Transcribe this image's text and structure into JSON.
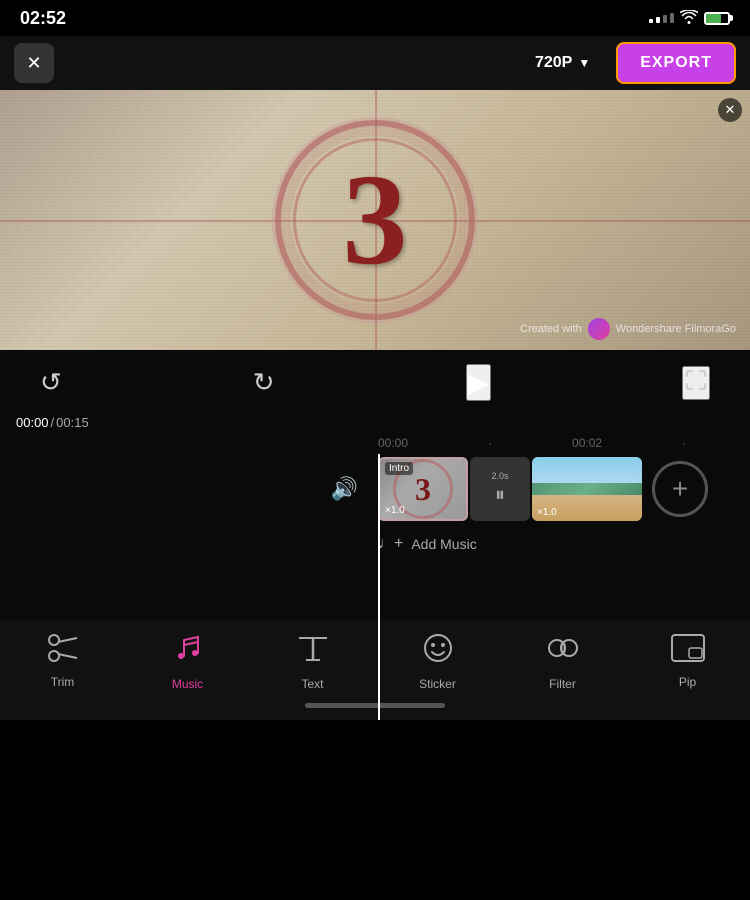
{
  "statusBar": {
    "time": "02:52",
    "wifiIcon": "wifi",
    "batteryIcon": "battery"
  },
  "topBar": {
    "closeLabel": "✕",
    "qualityLabel": "720P",
    "qualityChevron": "▼",
    "exportLabel": "EXPORT"
  },
  "videoPreview": {
    "countdownNumber": "3",
    "watermarkText": "Created with",
    "watermarkBrand": "Wondershare FilmoraGo",
    "closeWatermark": "✕"
  },
  "controls": {
    "undoIcon": "↺",
    "redoIcon": "↻",
    "playIcon": "▶",
    "fullscreenIcon": "⛶"
  },
  "timeline": {
    "currentTime": "00:00",
    "totalTime": "00:15",
    "separator": "/",
    "playheadTime": "00:00",
    "marker1": "00:02",
    "marker2": "00:0",
    "volumeIcon": "🔊"
  },
  "clips": [
    {
      "label": "Intro",
      "number": "3",
      "speed": "×1.0",
      "type": "countdown"
    },
    {
      "label": "2.0s",
      "type": "transition"
    },
    {
      "speed": "×1.0",
      "type": "video"
    }
  ],
  "addClipButton": "+",
  "musicTrack": {
    "icon": "♩+",
    "label": "Add Music"
  },
  "toolbar": {
    "items": [
      {
        "id": "trim",
        "icon": "trim",
        "label": "Trim",
        "active": false
      },
      {
        "id": "music",
        "icon": "music",
        "label": "Music",
        "active": true
      },
      {
        "id": "text",
        "icon": "text",
        "label": "Text",
        "active": false
      },
      {
        "id": "sticker",
        "icon": "sticker",
        "label": "Sticker",
        "active": false
      },
      {
        "id": "filter",
        "icon": "filter",
        "label": "Filter",
        "active": false
      },
      {
        "id": "pip",
        "icon": "pip",
        "label": "Pip",
        "active": false
      }
    ]
  }
}
